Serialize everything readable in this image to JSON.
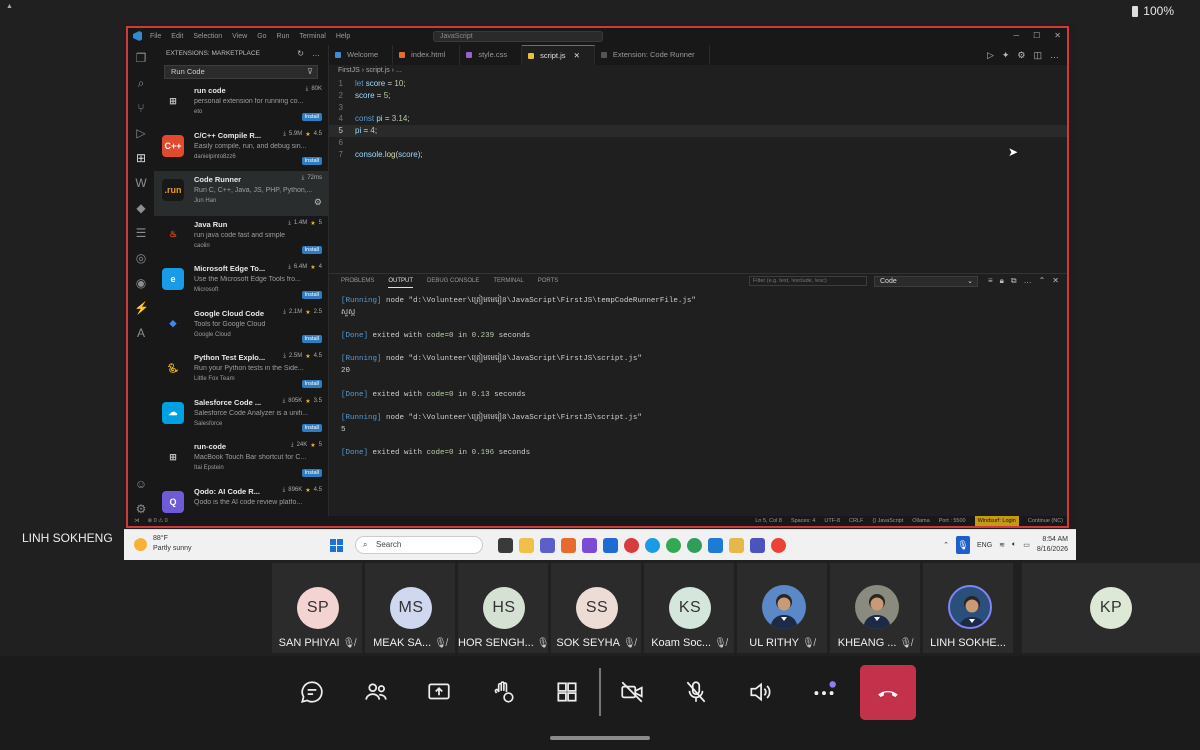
{
  "device": {
    "left_indicator": "▲",
    "battery": "100%"
  },
  "vscode": {
    "menu": [
      "File",
      "Edit",
      "Selection",
      "View",
      "Go",
      "Run",
      "Terminal",
      "Help"
    ],
    "title_search": "JavaScript",
    "sidebar_title": "EXTENSIONS: MARKETPLACE",
    "search_value": "Run Code",
    "extensions": [
      {
        "name": "run code",
        "desc": "personal extension for running co...",
        "publisher": "eto",
        "stat": "80K",
        "rating": "",
        "action": "Install"
      },
      {
        "name": "C/C++ Compile R...",
        "desc": "Easily compile, run, and debug sin...",
        "publisher": "danielpinto8zz6",
        "stat": "5.9M",
        "rating": "4.5",
        "action": "Install"
      },
      {
        "name": "Code Runner",
        "desc": "Run C, C++, Java, JS, PHP, Python,...",
        "publisher": "Jun Han",
        "stat": "72ms",
        "rating": "",
        "action": ""
      },
      {
        "name": "Java Run",
        "desc": "run java code fast and simple",
        "publisher": "caolin",
        "stat": "1.4M",
        "rating": "5",
        "action": "Install"
      },
      {
        "name": "Microsoft Edge To...",
        "desc": "Use the Microsoft Edge Tools fro...",
        "publisher": "Microsoft",
        "stat": "6.4M",
        "rating": "4",
        "action": "Install"
      },
      {
        "name": "Google Cloud Code",
        "desc": "Tools for Google Cloud",
        "publisher": "Google Cloud",
        "stat": "2.1M",
        "rating": "2.5",
        "action": "Install"
      },
      {
        "name": "Python Test Explo...",
        "desc": "Run your Python tests in the Side...",
        "publisher": "Little Fox Team",
        "stat": "2.5M",
        "rating": "4.5",
        "action": "Install"
      },
      {
        "name": "Salesforce Code ...",
        "desc": "Salesforce Code Analyzer is a unifi...",
        "publisher": "Salesforce",
        "stat": "805K",
        "rating": "3.5",
        "action": "Install"
      },
      {
        "name": "run-code",
        "desc": "MacBook Touch Bar shortcut for C...",
        "publisher": "Itai Epstein",
        "stat": "24K",
        "rating": "5",
        "action": "Install"
      },
      {
        "name": "Qodo: AI Code R...",
        "desc": "Qodo is the AI code review platfo...",
        "publisher": "",
        "stat": "896K",
        "rating": "4.5",
        "action": ""
      }
    ],
    "tabs": [
      "Welcome",
      "index.html",
      "style.css",
      "script.js",
      "Extension: Code Runner"
    ],
    "breadcrumb": "FirstJS › script.js › ...",
    "line_numbers": [
      "1",
      "2",
      "3",
      "4",
      "5",
      "6",
      "7"
    ],
    "panel_tabs": [
      "PROBLEMS",
      "OUTPUT",
      "DEBUG CONSOLE",
      "TERMINAL",
      "PORTS"
    ],
    "panel_filter": "Filter (e.g. text, !exclude, \\esc)",
    "panel_channel": "Code",
    "output": [
      "[Running] node \"d:\\Volunteer\\ត្រៀមមេរៀន\\JavaScript\\FirstJS\\tempCodeRunnerFile.js\"",
      "សួស្ត",
      "",
      "[Done] exited with code=0 in 0.239 seconds",
      "",
      "[Running] node \"d:\\Volunteer\\ត្រៀមមេរៀន\\JavaScript\\FirstJS\\script.js\"",
      "20",
      "",
      "[Done] exited with code=0 in 0.13 seconds",
      "",
      "[Running] node \"d:\\Volunteer\\ត្រៀមមេរៀន\\JavaScript\\FirstJS\\script.js\"",
      "5",
      "",
      "[Done] exited with code=0 in 0.196 seconds"
    ],
    "status_left": [
      "⊗ 0 ⚠ 0"
    ],
    "status_right": [
      "Ln 5, Col 8",
      "Spaces: 4",
      "UTF-8",
      "CRLF",
      "{} JavaScript",
      "Ollama",
      "Port : 5500",
      "Windsurf: Login",
      "Continue (NC)"
    ]
  },
  "taskbar": {
    "temp": "88°F",
    "weather": "Partly sunny",
    "search": "Search",
    "lang": "ENG",
    "time": "8:54 AM",
    "date": "8/16/2026"
  },
  "presenter": "LINH SOKHENG",
  "participants": [
    {
      "initials": "SP",
      "name": "SAN PHIYAI",
      "color": "#f4d3d3",
      "photo": false
    },
    {
      "initials": "MS",
      "name": "MEAK SA...",
      "color": "#cfd8ef",
      "photo": false
    },
    {
      "initials": "HS",
      "name": "HOR SENGH...",
      "color": "#d5e2d3",
      "photo": false
    },
    {
      "initials": "SS",
      "name": "SOK SEYHA",
      "color": "#ecdcd5",
      "photo": false
    },
    {
      "initials": "KS",
      "name": "Koam Soc...",
      "color": "#d5e6dd",
      "photo": false
    },
    {
      "initials": "",
      "name": "UL RITHY",
      "color": "#5b89c7",
      "photo": true
    },
    {
      "initials": "",
      "name": "KHEANG ...",
      "color": "#8a8a7e",
      "photo": true
    },
    {
      "initials": "",
      "name": "LINH SOKHE...",
      "color": "#2a4f7a",
      "photo": true
    }
  ],
  "extra_participant": {
    "initials": "KP",
    "color": "#dde8d6"
  }
}
